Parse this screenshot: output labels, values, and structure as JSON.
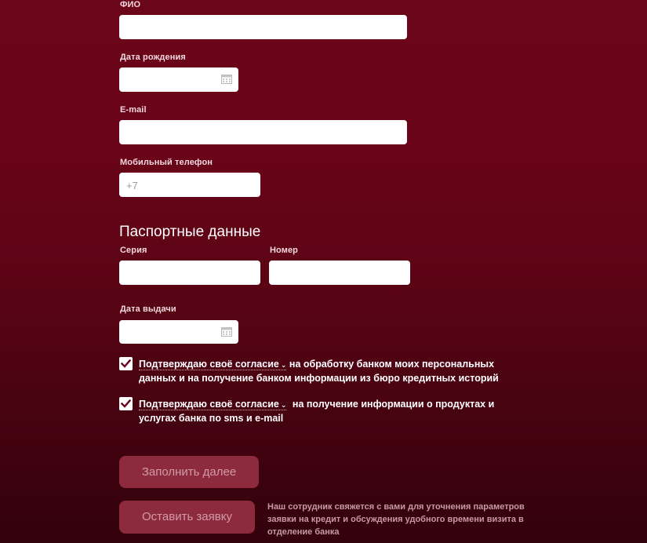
{
  "personal": {
    "fio_label": "ФИО",
    "fio_value": "",
    "birthdate_label": "Дата рождения",
    "birthdate_value": "",
    "email_label": "E-mail",
    "email_value": "",
    "phone_label": "Мобильный телефон",
    "phone_placeholder": "+7"
  },
  "passport": {
    "title": "Паспортные данные",
    "series_label": "Серия",
    "number_label": "Номер",
    "issue_date_label": "Дата выдачи"
  },
  "consents": [
    {
      "checked": true,
      "link_text": "Подтверждаю своё согласие",
      "line1_rest": "на обработку банком моих персональных",
      "line2": "данных и на получение банком информации из бюро кредитных историй"
    },
    {
      "checked": true,
      "link_text": "Подтверждаю своё согласие",
      "line1_rest": "на получение информации о продуктах и",
      "line2": "услугах банка по sms и e-mail"
    }
  ],
  "buttons": {
    "continue_label": "Заполнить далее",
    "submit_label": "Оставить заявку"
  },
  "note": {
    "line1": "Наш сотрудник свяжется с вами для уточнения параметров",
    "line2": "заявки на кредит и обсуждения удобного времени визита в",
    "line3": "отделение банка"
  },
  "colors": {
    "background_top": "#6b0519",
    "background_bottom": "#32020b",
    "button_bg": "#8e2a3e",
    "button_text": "#cf9ca6"
  }
}
